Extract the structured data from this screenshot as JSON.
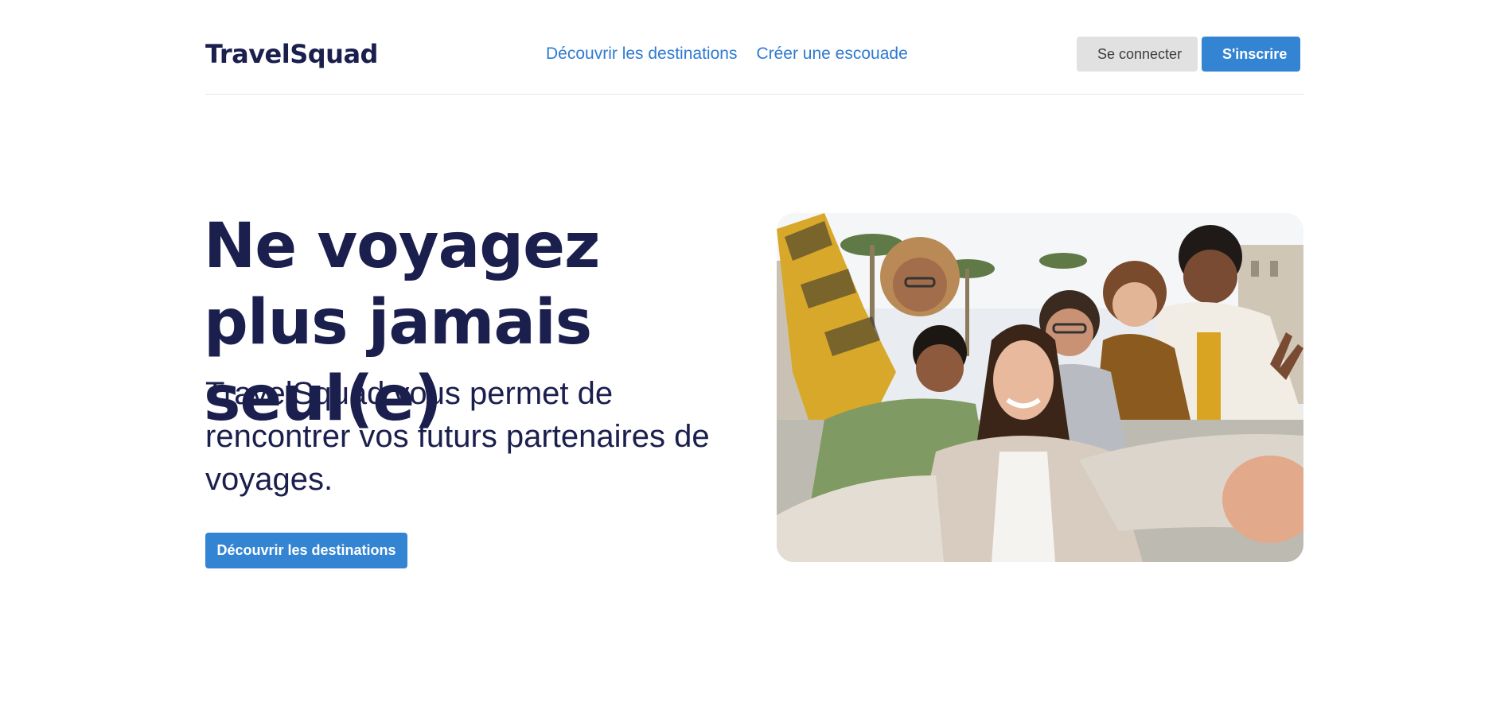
{
  "brand": {
    "name": "TravelSquad"
  },
  "nav": {
    "items": [
      {
        "label": "Découvrir les destinations"
      },
      {
        "label": "Créer une escouade"
      }
    ]
  },
  "auth": {
    "login_label": "Se connecter",
    "signup_label": "S'inscrire"
  },
  "hero": {
    "title": "Ne voyagez plus jamais seul(e)",
    "subtitle": "TravelSquad vous permet de rencontrer vos futurs partenaires de voyages.",
    "cta_label": "Découvrir les destinations"
  },
  "colors": {
    "brand_navy": "#1b1f4d",
    "accent_blue": "#3484d4",
    "link_blue": "#2f7ad1",
    "secondary_button": "#e1e1e1"
  }
}
